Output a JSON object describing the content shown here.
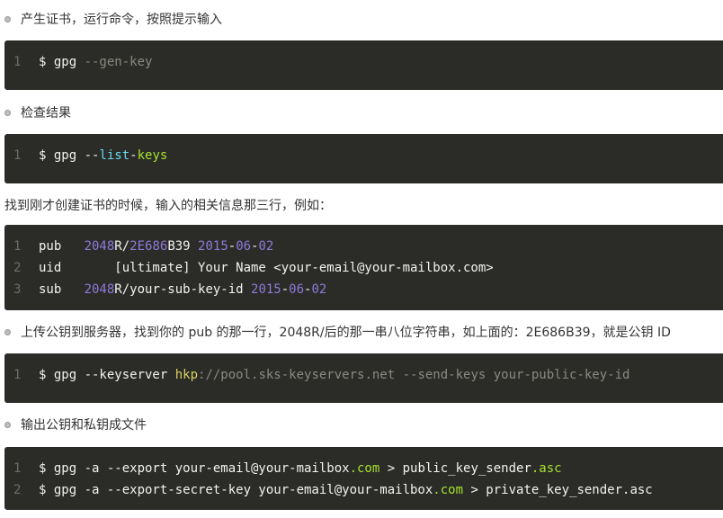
{
  "sections": {
    "s1": {
      "text": "产生证书，运行命令，按照提示输入",
      "code": [
        {
          "num": "1",
          "tokens": [
            {
              "t": "$ gpg ",
              "c": "plain"
            },
            {
              "t": "--gen-key",
              "c": "dim"
            }
          ]
        }
      ]
    },
    "s2": {
      "text": "检查结果",
      "code": [
        {
          "num": "1",
          "tokens": [
            {
              "t": "$ gpg --",
              "c": "plain"
            },
            {
              "t": "list",
              "c": "builtin"
            },
            {
              "t": "-",
              "c": "plain"
            },
            {
              "t": "keys",
              "c": "green"
            }
          ]
        }
      ]
    },
    "s3": {
      "text": "找到刚才创建证书的时候，输入的相关信息那三行，例如：",
      "code": [
        {
          "num": "1",
          "tokens": [
            {
              "t": "pub   ",
              "c": "plain"
            },
            {
              "t": "2048",
              "c": "num"
            },
            {
              "t": "R/",
              "c": "plain"
            },
            {
              "t": "2E686",
              "c": "num"
            },
            {
              "t": "B39 ",
              "c": "plain"
            },
            {
              "t": "2015",
              "c": "num"
            },
            {
              "t": "-",
              "c": "plain"
            },
            {
              "t": "06",
              "c": "num"
            },
            {
              "t": "-",
              "c": "plain"
            },
            {
              "t": "02",
              "c": "num"
            }
          ]
        },
        {
          "num": "2",
          "tokens": [
            {
              "t": "uid       [ultimate] Your Name <your-email@your-mailbox.com>",
              "c": "plain"
            }
          ]
        },
        {
          "num": "3",
          "tokens": [
            {
              "t": "sub   ",
              "c": "plain"
            },
            {
              "t": "2048",
              "c": "num"
            },
            {
              "t": "R/your-sub-key-id ",
              "c": "plain"
            },
            {
              "t": "2015",
              "c": "num"
            },
            {
              "t": "-",
              "c": "plain"
            },
            {
              "t": "06",
              "c": "num"
            },
            {
              "t": "-",
              "c": "plain"
            },
            {
              "t": "02",
              "c": "num"
            }
          ]
        }
      ]
    },
    "s4": {
      "text": "上传公钥到服务器，找到你的 pub 的那一行，2048R/后的那一串八位字符串，如上面的：2E686B39，就是公钥 ID",
      "code": [
        {
          "num": "1",
          "tokens": [
            {
              "t": "$ gpg --keyserver ",
              "c": "plain"
            },
            {
              "t": "hkp",
              "c": "yellow"
            },
            {
              "t": "://pool.sks-keyservers.net --send-keys your-public-key-id",
              "c": "dim"
            }
          ]
        }
      ]
    },
    "s5": {
      "text": "输出公钥和私钥成文件",
      "code": [
        {
          "num": "1",
          "tokens": [
            {
              "t": "$ gpg -a --export your-email@your-mailbox",
              "c": "plain"
            },
            {
              "t": ".com",
              "c": "green"
            },
            {
              "t": " > public_key_sender",
              "c": "plain"
            },
            {
              "t": ".asc",
              "c": "green"
            }
          ]
        },
        {
          "num": "2",
          "tokens": [
            {
              "t": "$ gpg -a --export-secret-key your-email@your-mailbox",
              "c": "plain"
            },
            {
              "t": ".com",
              "c": "green"
            },
            {
              "t": " > private_key_sender.asc",
              "c": "plain"
            }
          ]
        }
      ]
    }
  },
  "colors": {
    "code_bg": "#2b2b28",
    "code_text": "#f2f2ee",
    "line_number": "#6e6e66",
    "number_token": "#8f7ad8",
    "builtin_token": "#66d9ef",
    "green_token": "#a6e22e",
    "yellow_token": "#d8d260",
    "dim_token": "#8a8a82"
  }
}
